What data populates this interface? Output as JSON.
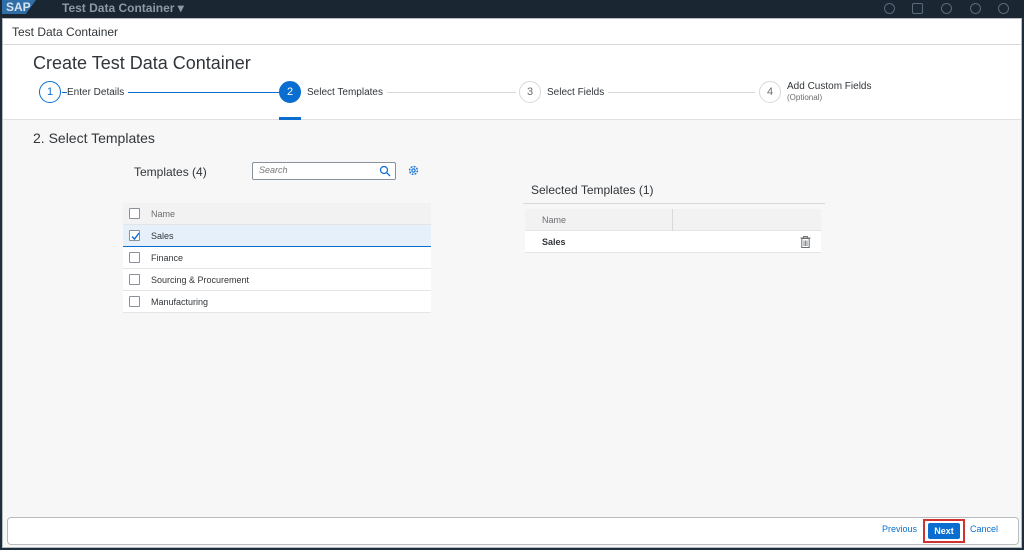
{
  "shell": {
    "logo": "SAP",
    "title": "Test Data Container ▾"
  },
  "dialog": {
    "header": "Test Data Container"
  },
  "page": {
    "title": "Create Test Data Container"
  },
  "wizard": {
    "steps": [
      {
        "number": "1",
        "label": "Enter Details",
        "sub": ""
      },
      {
        "number": "2",
        "label": "Select Templates",
        "sub": ""
      },
      {
        "number": "3",
        "label": "Select Fields",
        "sub": ""
      },
      {
        "number": "4",
        "label": "Add Custom Fields",
        "sub": "(Optional)"
      }
    ]
  },
  "section": {
    "title": "2. Select Templates"
  },
  "templates": {
    "title": "Templates (4)",
    "search_placeholder": "Search",
    "header_name": "Name",
    "rows": [
      {
        "name": "Sales",
        "checked": true
      },
      {
        "name": "Finance",
        "checked": false
      },
      {
        "name": "Sourcing & Procurement",
        "checked": false
      },
      {
        "name": "Manufacturing",
        "checked": false
      }
    ]
  },
  "selected": {
    "title": "Selected Templates (1)",
    "header_name": "Name",
    "rows": [
      {
        "name": "Sales"
      }
    ]
  },
  "footer": {
    "previous": "Previous",
    "next": "Next",
    "cancel": "Cancel"
  },
  "colors": {
    "accent": "#0a6ed1",
    "highlight": "#d0332f",
    "selected_row": "#e5f0fa"
  }
}
